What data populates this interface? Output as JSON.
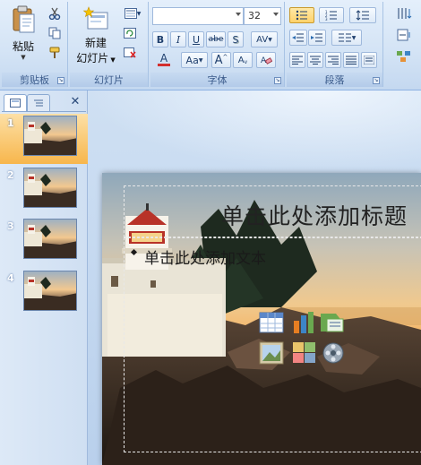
{
  "ribbon": {
    "clipboard": {
      "label": "剪贴板",
      "paste_label": "粘贴"
    },
    "slides": {
      "label": "幻灯片",
      "new_label_line1": "新建",
      "new_label_line2": "幻灯片"
    },
    "font": {
      "label": "字体",
      "font_name": "",
      "font_size": "32",
      "buttons": [
        "B",
        "I",
        "U",
        "abe",
        "S",
        "AV"
      ],
      "grow_label": "A",
      "case_label": "Aa"
    },
    "paragraph": {
      "label": "段落"
    }
  },
  "panel": {
    "thumbnails": [
      {
        "number": "1"
      },
      {
        "number": "2"
      },
      {
        "number": "3"
      },
      {
        "number": "4"
      }
    ],
    "close_glyph": "✕"
  },
  "slide": {
    "title_placeholder": "单击此处添加标题",
    "body_placeholder": "单击此处添加文本"
  },
  "colors": {
    "ribbon_border": "#8db2e3",
    "selected_thumb": "#f7b64c",
    "accent": "#3b5b8b"
  }
}
